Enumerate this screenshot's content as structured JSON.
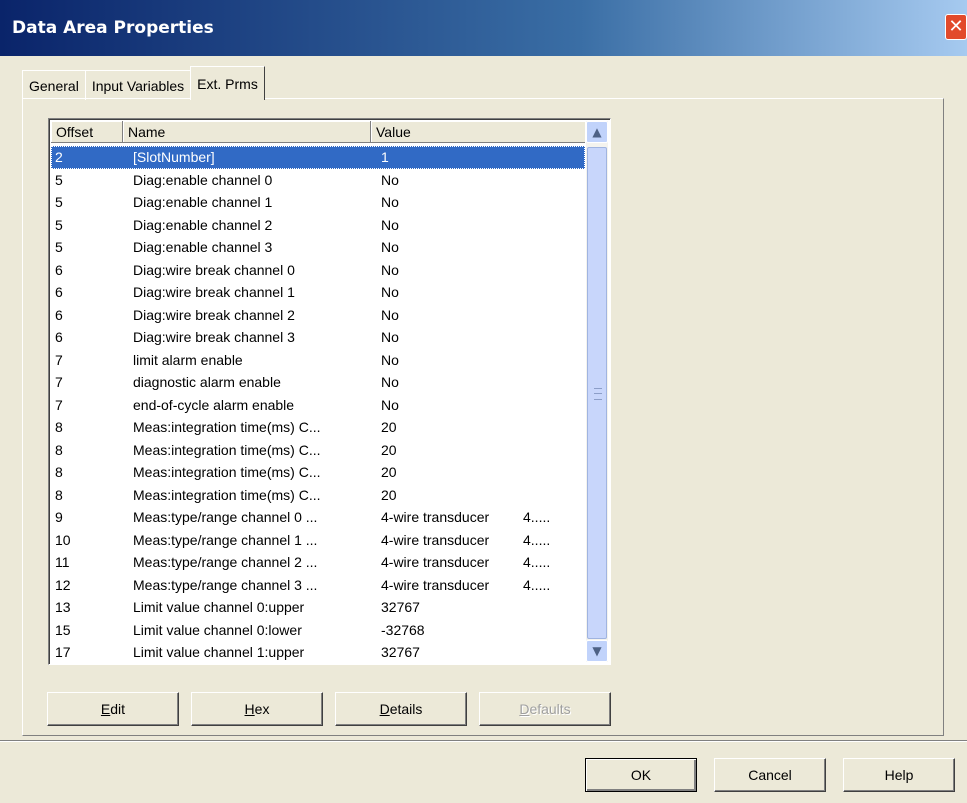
{
  "window": {
    "title": "Data Area Properties"
  },
  "tabs": [
    {
      "label": "General"
    },
    {
      "label": "Input Variables"
    },
    {
      "label": "Ext. Prms"
    }
  ],
  "list": {
    "columns": [
      "Offset",
      "Name",
      "Value"
    ],
    "rows": [
      {
        "offset": "2",
        "name": "[SlotNumber]",
        "value": "1",
        "extra": ""
      },
      {
        "offset": "5",
        "name": "Diag:enable channel 0",
        "value": "No",
        "extra": ""
      },
      {
        "offset": "5",
        "name": "Diag:enable channel 1",
        "value": "No",
        "extra": ""
      },
      {
        "offset": "5",
        "name": "Diag:enable channel 2",
        "value": "No",
        "extra": ""
      },
      {
        "offset": "5",
        "name": "Diag:enable channel 3",
        "value": "No",
        "extra": ""
      },
      {
        "offset": "6",
        "name": "Diag:wire break channel 0",
        "value": "No",
        "extra": ""
      },
      {
        "offset": "6",
        "name": "Diag:wire break channel 1",
        "value": "No",
        "extra": ""
      },
      {
        "offset": "6",
        "name": "Diag:wire break channel 2",
        "value": "No",
        "extra": ""
      },
      {
        "offset": "6",
        "name": "Diag:wire break channel 3",
        "value": "No",
        "extra": ""
      },
      {
        "offset": "7",
        "name": "limit alarm enable",
        "value": "No",
        "extra": ""
      },
      {
        "offset": "7",
        "name": "diagnostic alarm enable",
        "value": "No",
        "extra": ""
      },
      {
        "offset": "7",
        "name": "end-of-cycle alarm enable",
        "value": "No",
        "extra": ""
      },
      {
        "offset": "8",
        "name": "Meas:integration time(ms) C...",
        "value": "20",
        "extra": ""
      },
      {
        "offset": "8",
        "name": "Meas:integration time(ms) C...",
        "value": "20",
        "extra": ""
      },
      {
        "offset": "8",
        "name": "Meas:integration time(ms) C...",
        "value": "20",
        "extra": ""
      },
      {
        "offset": "8",
        "name": "Meas:integration time(ms) C...",
        "value": "20",
        "extra": ""
      },
      {
        "offset": "9",
        "name": "Meas:type/range channel 0 ...",
        "value": "4-wire transducer",
        "extra": "4....."
      },
      {
        "offset": "10",
        "name": "Meas:type/range channel 1 ...",
        "value": "4-wire transducer",
        "extra": "4....."
      },
      {
        "offset": "11",
        "name": "Meas:type/range channel 2 ...",
        "value": "4-wire transducer",
        "extra": "4....."
      },
      {
        "offset": "12",
        "name": "Meas:type/range channel 3 ...",
        "value": "4-wire transducer",
        "extra": "4....."
      },
      {
        "offset": "13",
        "name": "Limit value channel 0:upper",
        "value": "32767",
        "extra": ""
      },
      {
        "offset": "15",
        "name": "Limit value channel 0:lower",
        "value": "-32768",
        "extra": ""
      },
      {
        "offset": "17",
        "name": "Limit value channel 1:upper",
        "value": "32767",
        "extra": ""
      }
    ]
  },
  "tab_buttons": {
    "edit_prefix": "E",
    "edit_rest": "dit",
    "hex_prefix": "H",
    "hex_rest": "ex",
    "details_prefix": "D",
    "details_rest": "etails",
    "defaults_prefix": "D",
    "defaults_rest": "efaults"
  },
  "dialog_buttons": {
    "ok": "OK",
    "cancel": "Cancel",
    "help": "Help"
  },
  "icons": {
    "close": "close-icon",
    "scroll_up": "chevron-up-icon",
    "scroll_down": "chevron-down-icon"
  }
}
